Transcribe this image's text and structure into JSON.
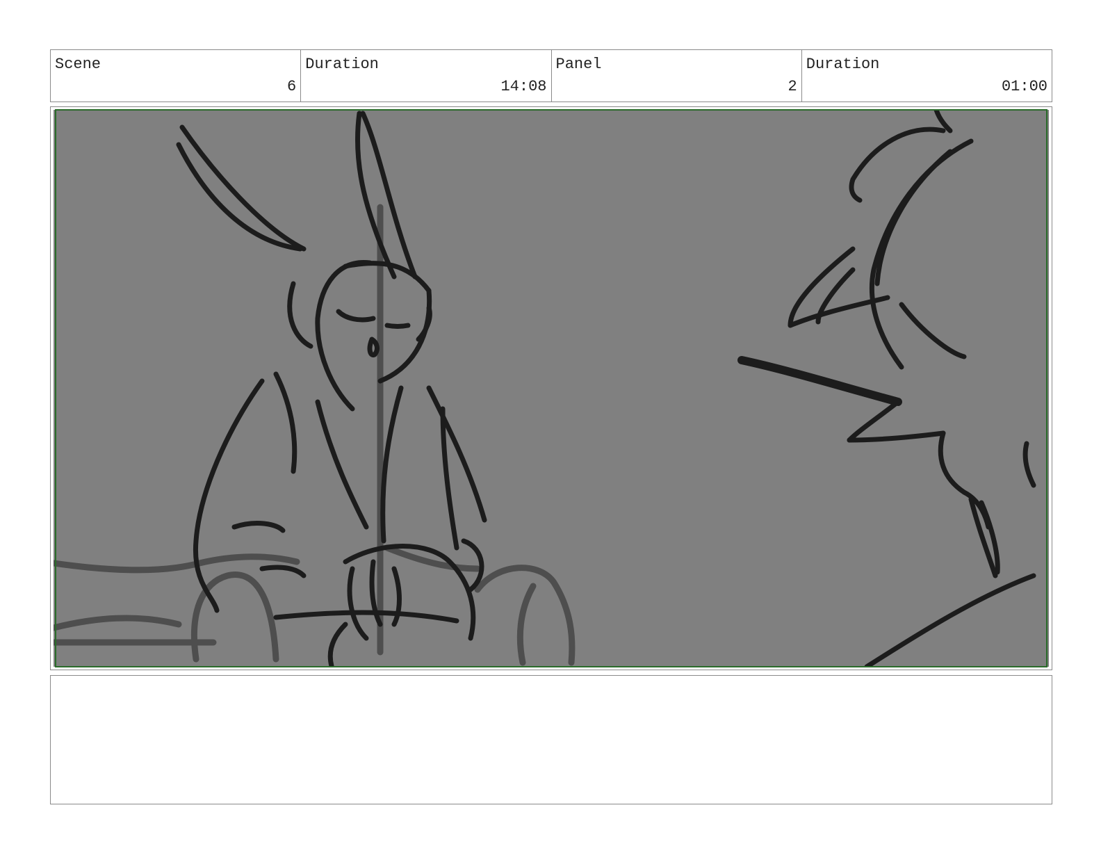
{
  "header": {
    "scene": {
      "label": "Scene",
      "value": "6"
    },
    "scene_duration": {
      "label": "Duration",
      "value": "14:08"
    },
    "panel": {
      "label": "Panel",
      "value": "2"
    },
    "panel_duration": {
      "label": "Duration",
      "value": "01:00"
    }
  },
  "panel_image": {
    "background": "#808080",
    "safe_frame_color": "#2a6b2a"
  },
  "notes": {
    "text": ""
  }
}
